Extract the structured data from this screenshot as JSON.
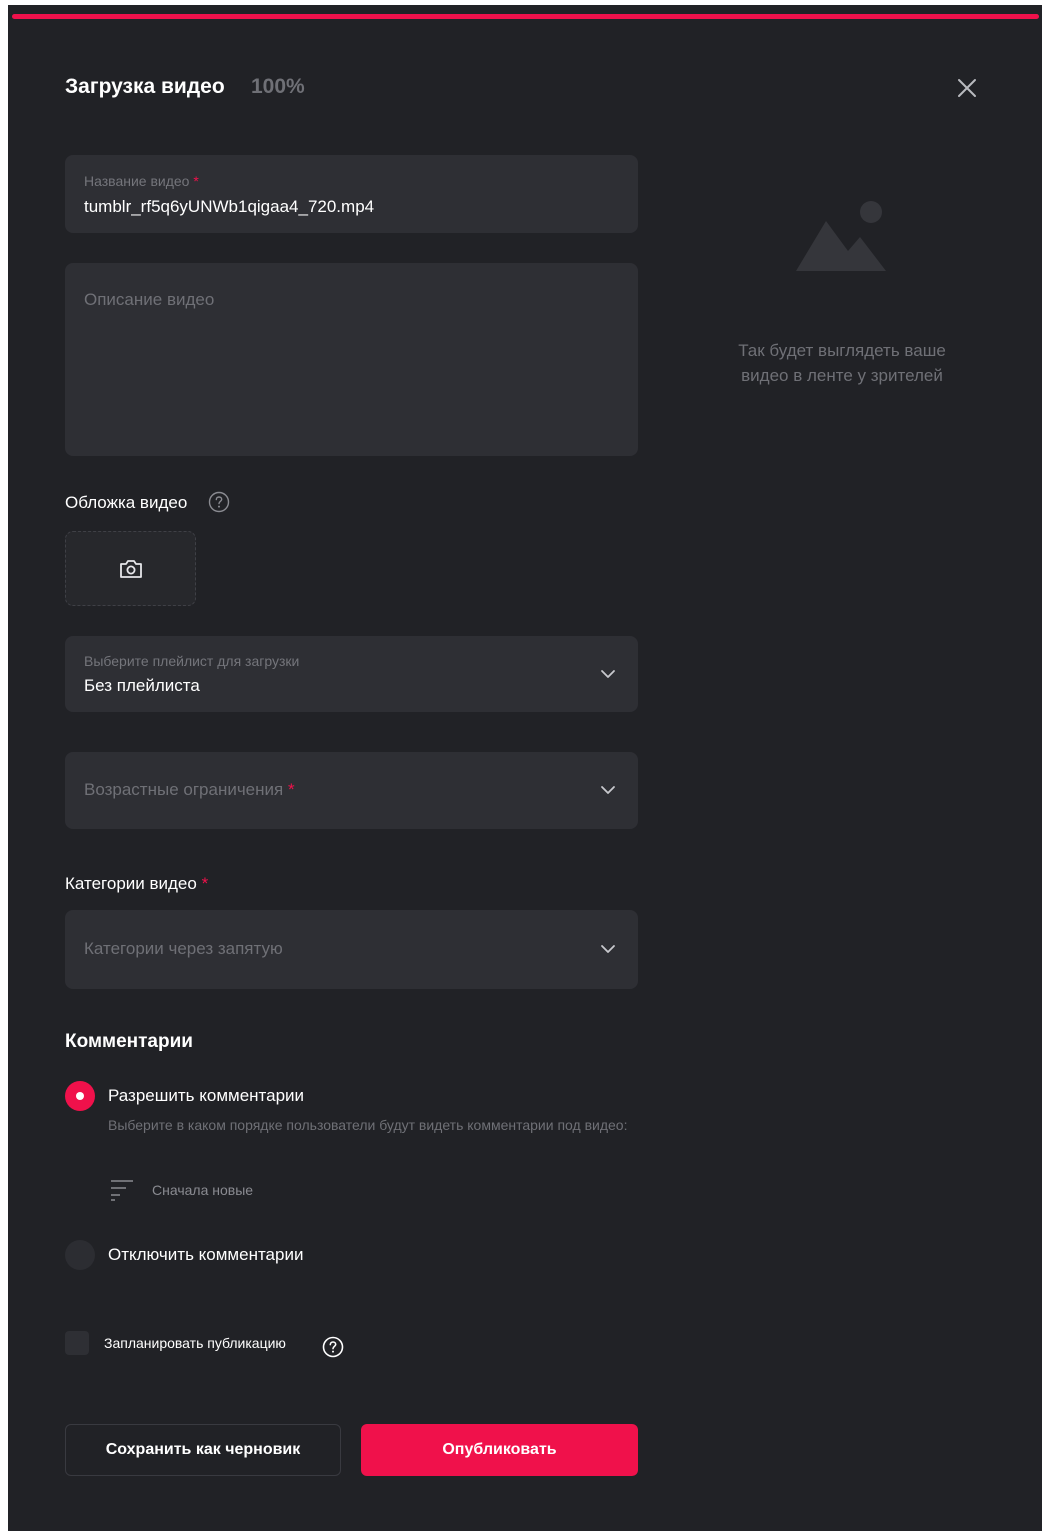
{
  "upload": {
    "title": "Загрузка видео",
    "progress_text": "100%",
    "progress": 1.0
  },
  "form": {
    "name_label": "Название видео",
    "name_required": "*",
    "name_value": "tumblr_rf5q6yUNWb1qigaa4_720.mp4",
    "description_placeholder": "Описание видео",
    "cover_label": "Обложка видео",
    "playlist_label": "Выберите плейлист для загрузки",
    "playlist_value": "Без плейлиста",
    "age_placeholder": "Возрастные ограничения",
    "age_required": "*",
    "categories_label": "Категории видео",
    "categories_required": "*",
    "categories_placeholder": "Категории через запятую"
  },
  "preview": {
    "text": "Так будет выглядеть ваше видео в ленте у зрителей"
  },
  "comments": {
    "title": "Комментарии",
    "allow_label": "Разрешить комментарии",
    "allow_desc": "Выберите в каком порядке пользователи будут видеть комментарии под видео:",
    "sort_label": "Сначала новые",
    "disable_label": "Отключить комментарии",
    "selected": "allow"
  },
  "schedule": {
    "label": "Запланировать публикацию",
    "checked": false
  },
  "actions": {
    "draft_label": "Сохранить как черновик",
    "publish_label": "Опубликовать"
  },
  "colors": {
    "accent": "#f0114b",
    "background": "#212226",
    "field": "#2e2f34"
  }
}
